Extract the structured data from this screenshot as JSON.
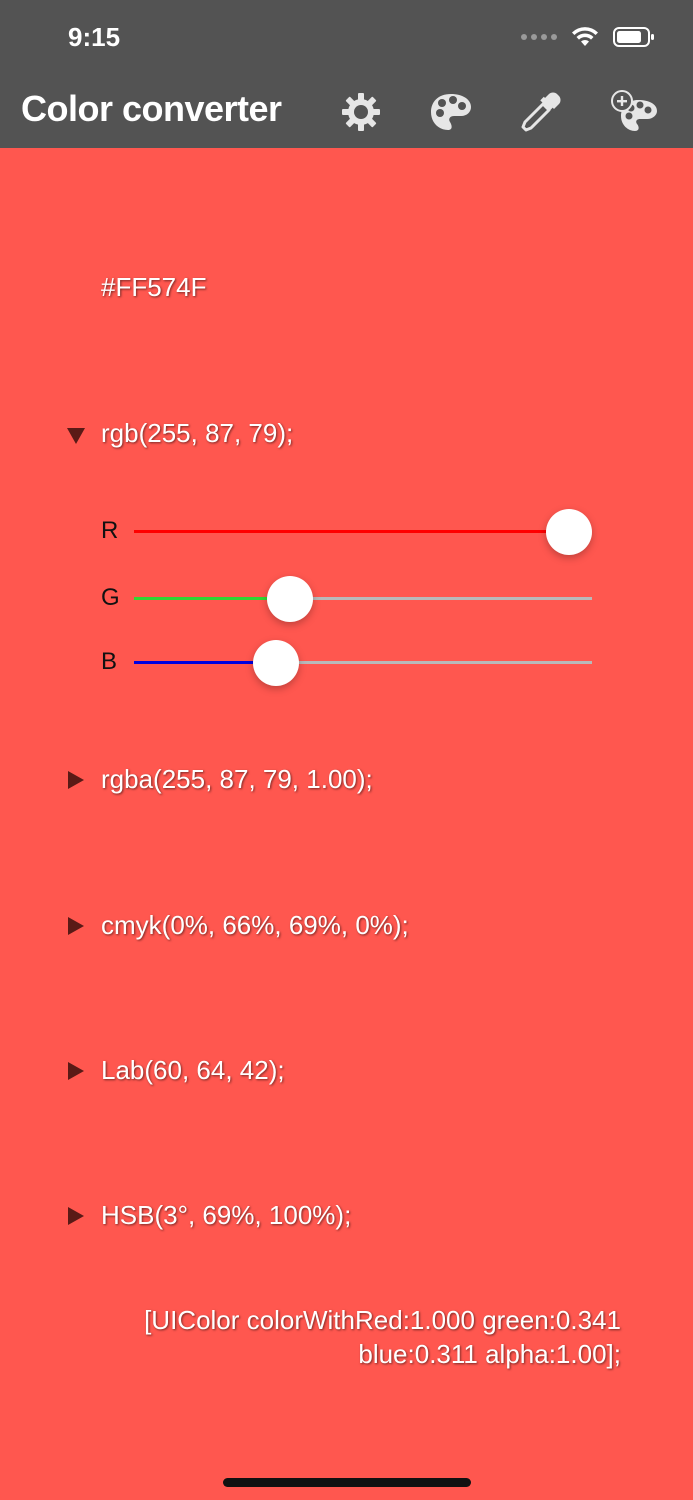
{
  "status_bar": {
    "time": "9:15"
  },
  "nav": {
    "title": "Color converter"
  },
  "colors": {
    "background": "#FF574F",
    "bar": "#535353",
    "red": "#FF0000",
    "green": "#33D633",
    "blue": "#0000E0"
  },
  "hex": "#FF574F",
  "rgb": {
    "text": "rgb(255, 87, 79);",
    "expanded": true
  },
  "sliders": [
    {
      "label": "R",
      "value": 255,
      "max": 255
    },
    {
      "label": "G",
      "value": 87,
      "max": 255
    },
    {
      "label": "B",
      "value": 79,
      "max": 255
    }
  ],
  "formats": {
    "rgba": "rgba(255, 87, 79, 1.00);",
    "cmyk": "cmyk(0%, 66%, 69%, 0%);",
    "lab": "Lab(60, 64, 42);",
    "hsb": "HSB(3°, 69%, 100%);"
  },
  "objc": {
    "line1": "[UIColor colorWithRed:1.000 green:0.341",
    "line2": "blue:0.311 alpha:1.00];"
  },
  "icons": [
    "settings-gear-icon",
    "palette-icon",
    "eyedropper-icon",
    "add-palette-icon"
  ]
}
